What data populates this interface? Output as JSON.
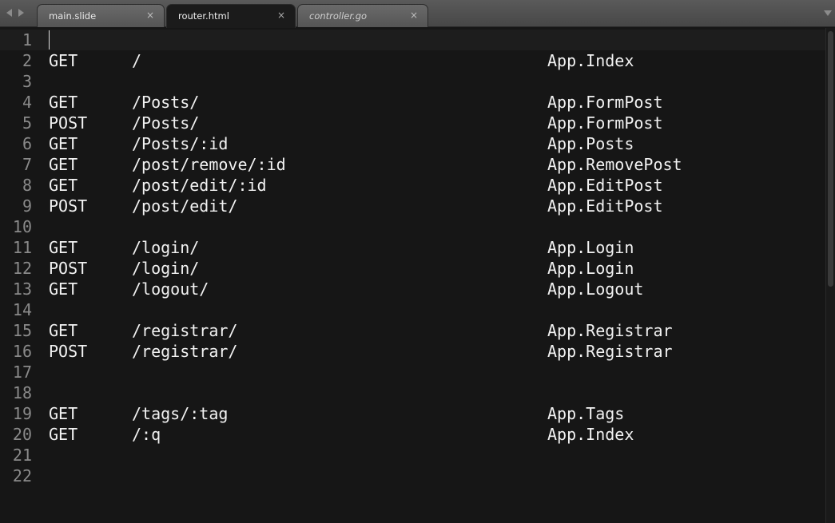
{
  "tabs": [
    {
      "label": "main.slide",
      "close": "×"
    },
    {
      "label": "router.html",
      "close": "×"
    },
    {
      "label": "controller.go",
      "close": "×"
    }
  ],
  "lines": [
    {
      "num": "1",
      "method": "",
      "path": "",
      "action": ""
    },
    {
      "num": "2",
      "method": "GET",
      "path": "/",
      "action": "App.Index"
    },
    {
      "num": "3",
      "method": "",
      "path": "",
      "action": ""
    },
    {
      "num": "4",
      "method": "GET",
      "path": "/Posts/",
      "action": "App.FormPost"
    },
    {
      "num": "5",
      "method": "POST",
      "path": "/Posts/",
      "action": "App.FormPost"
    },
    {
      "num": "6",
      "method": "GET",
      "path": "/Posts/:id",
      "action": "App.Posts"
    },
    {
      "num": "7",
      "method": "GET",
      "path": "/post/remove/:id",
      "action": "App.RemovePost"
    },
    {
      "num": "8",
      "method": "GET",
      "path": "/post/edit/:id",
      "action": "App.EditPost"
    },
    {
      "num": "9",
      "method": "POST",
      "path": "/post/edit/",
      "action": "App.EditPost"
    },
    {
      "num": "10",
      "method": "",
      "path": "",
      "action": ""
    },
    {
      "num": "11",
      "method": "GET",
      "path": "/login/",
      "action": "App.Login"
    },
    {
      "num": "12",
      "method": "POST",
      "path": "/login/",
      "action": "App.Login"
    },
    {
      "num": "13",
      "method": "GET",
      "path": "/logout/",
      "action": "App.Logout"
    },
    {
      "num": "14",
      "method": "",
      "path": "",
      "action": ""
    },
    {
      "num": "15",
      "method": "GET",
      "path": "/registrar/",
      "action": "App.Registrar"
    },
    {
      "num": "16",
      "method": "POST",
      "path": "/registrar/",
      "action": "App.Registrar"
    },
    {
      "num": "17",
      "method": "",
      "path": "",
      "action": ""
    },
    {
      "num": "18",
      "method": "",
      "path": "",
      "action": ""
    },
    {
      "num": "19",
      "method": "GET",
      "path": "/tags/:tag",
      "action": "App.Tags"
    },
    {
      "num": "20",
      "method": "GET",
      "path": "/:q",
      "action": "App.Index"
    },
    {
      "num": "21",
      "method": "",
      "path": "",
      "action": ""
    },
    {
      "num": "22",
      "method": "",
      "path": "",
      "action": ""
    }
  ]
}
